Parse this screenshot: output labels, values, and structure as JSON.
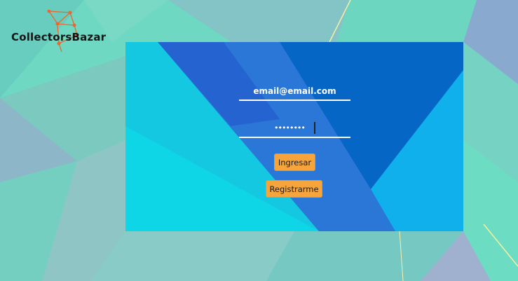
{
  "app": {
    "logo_text": "CollectorsBazar"
  },
  "login": {
    "email_value": "email@email.com",
    "password_mask": "••••••••",
    "login_button": "Ingresar",
    "register_button": "Registrarme"
  }
}
